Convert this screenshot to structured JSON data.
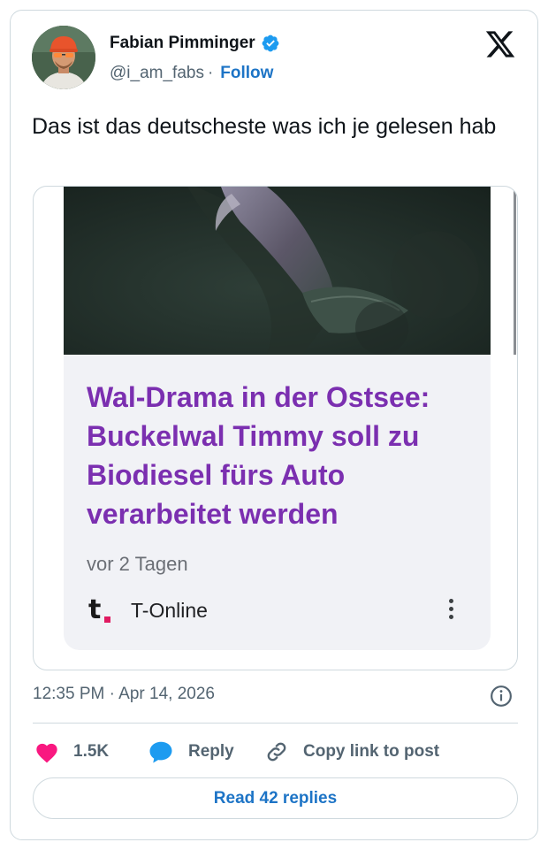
{
  "author": {
    "display_name": "Fabian Pimminger",
    "handle": "@i_am_fabs",
    "separator": "·",
    "follow_label": "Follow"
  },
  "tweet": {
    "text": "Das ist das deutscheste was ich je gelesen hab"
  },
  "embed_card": {
    "headline": "Wal-Drama in der Ostsee: Buckelwal Timmy soll zu Biodiesel fürs Auto verarbeitet werden",
    "age": "vor 2 Tagen",
    "source_logo_letter": "t",
    "source_name": "T-Online",
    "image_icon": "humpback-whale-underwater-photo"
  },
  "meta": {
    "timestamp": "12:35 PM · Apr 14, 2026"
  },
  "actions": {
    "like_count": "1.5K",
    "reply_label": "Reply",
    "copy_label": "Copy link to post"
  },
  "read_replies_label": "Read 42 replies",
  "colors": {
    "link_blue": "#1d74c6",
    "headline_purple": "#7b2fb0",
    "like_pink": "#f91880",
    "verified_blue": "#1d9bf0",
    "reply_blue": "#1d9bf0",
    "tonline_magenta": "#e01a61"
  }
}
